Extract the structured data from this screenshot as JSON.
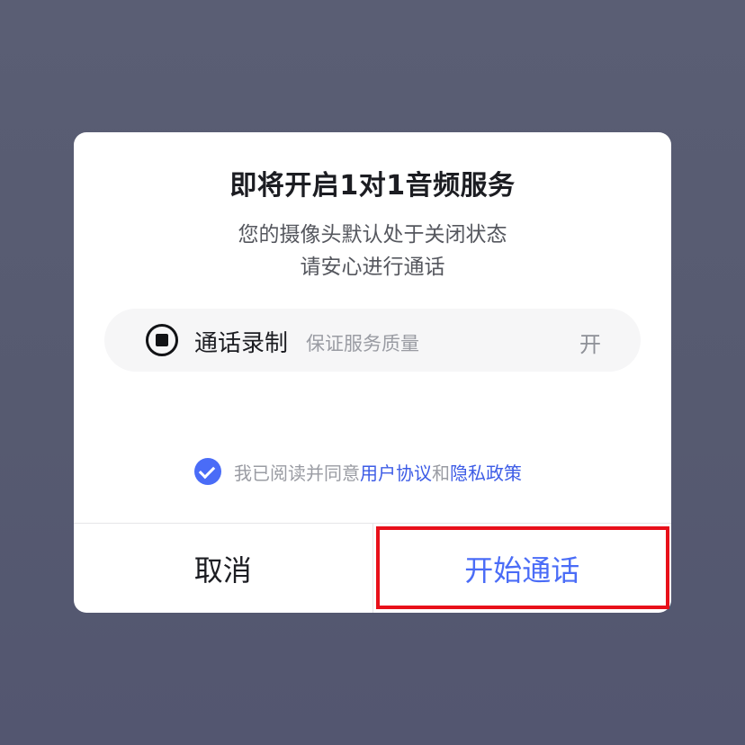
{
  "dialog": {
    "title": "即将开启1对1音频服务",
    "subtitle_line1": "您的摄像头默认处于关闭状态",
    "subtitle_line2": "请安心进行通话"
  },
  "recording": {
    "icon": "record-stop-icon",
    "label": "通话录制",
    "description": "保证服务质量",
    "status": "开"
  },
  "agreement": {
    "checked": true,
    "prefix": "我已阅读并同意",
    "user_agreement": "用户协议",
    "conjunction": "和",
    "privacy_policy": "隐私政策"
  },
  "buttons": {
    "cancel": "取消",
    "confirm": "开始通话"
  },
  "colors": {
    "accent": "#4a6cf7",
    "highlight": "#e8101a",
    "overlay": "#575b72"
  }
}
